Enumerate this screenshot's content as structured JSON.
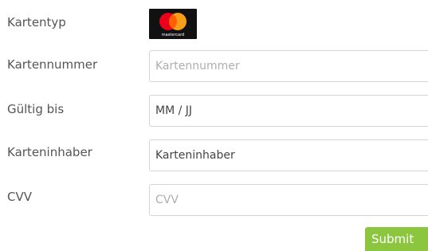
{
  "form": {
    "card_type": {
      "label": "Kartentyp",
      "brand_icon": "mastercard-logo",
      "brand_text": "mastercard",
      "colors": {
        "red": "#eb001b",
        "orange": "#f79e1b",
        "overlap": "#ff5f00",
        "background": "#111111"
      }
    },
    "card_number": {
      "label": "Kartennummer",
      "placeholder": "Kartennummer",
      "value": ""
    },
    "valid_until": {
      "label": "Gültig bis",
      "placeholder": "MM / JJ",
      "value": "MM / JJ"
    },
    "card_holder": {
      "label": "Karteninhaber",
      "placeholder": "Karteninhaber",
      "value": "Karteninhaber"
    },
    "cvv": {
      "label": "CVV",
      "placeholder": "CVV",
      "value": ""
    },
    "submit_label": "Submit",
    "accent_color": "#8cc63f"
  }
}
